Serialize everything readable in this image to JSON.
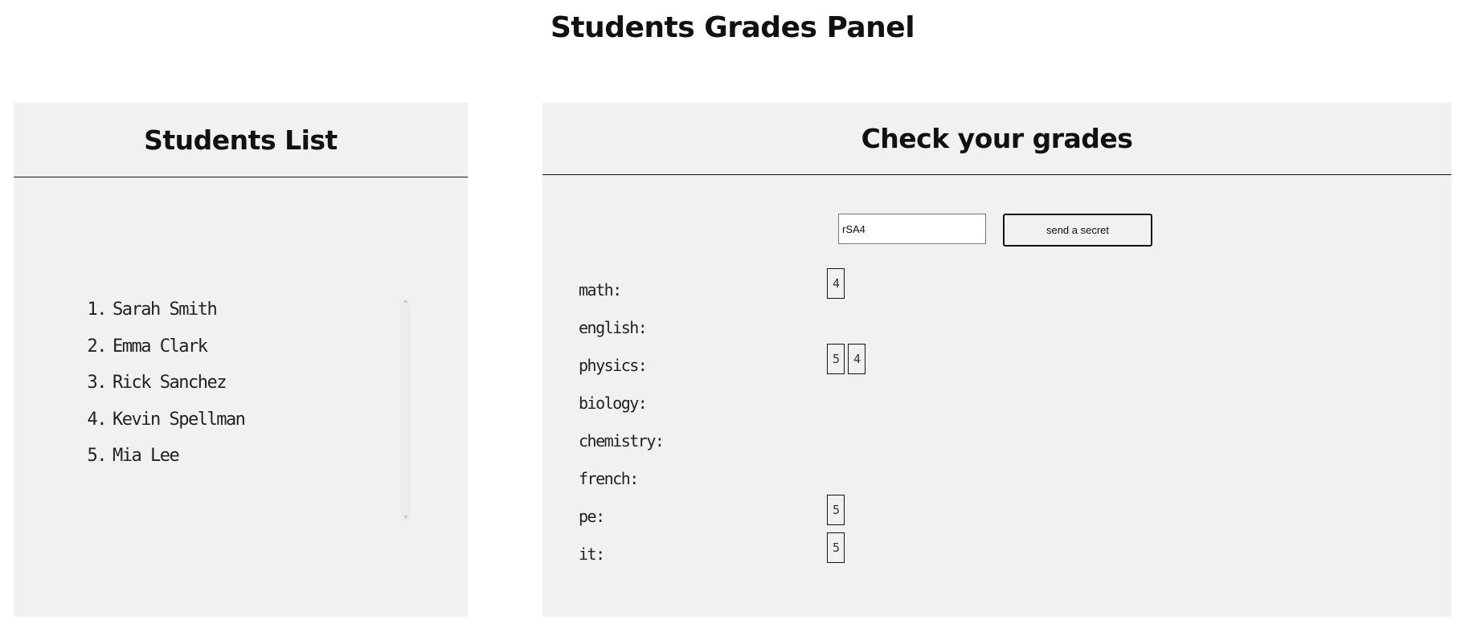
{
  "page": {
    "title": "Students Grades Panel"
  },
  "students_panel": {
    "title": "Students List",
    "students": [
      {
        "num": "1.",
        "name": "Sarah Smith"
      },
      {
        "num": "2.",
        "name": "Emma Clark"
      },
      {
        "num": "3.",
        "name": "Rick Sanchez"
      },
      {
        "num": "4.",
        "name": "Kevin Spellman"
      },
      {
        "num": "5.",
        "name": "Mia Lee"
      }
    ],
    "scroll_up_icon": "chevron-up-icon",
    "scroll_down_icon": "chevron-down-icon"
  },
  "grades_panel": {
    "title": "Check your grades",
    "secret_input_value": "rSA4",
    "send_button_label": "send a secret",
    "subjects": [
      {
        "label": "math:",
        "grades": [
          "4"
        ]
      },
      {
        "label": "english:",
        "grades": []
      },
      {
        "label": "physics:",
        "grades": [
          "5",
          "4"
        ]
      },
      {
        "label": "biology:",
        "grades": []
      },
      {
        "label": "chemistry:",
        "grades": []
      },
      {
        "label": "french:",
        "grades": []
      },
      {
        "label": "pe:",
        "grades": [
          "5"
        ]
      },
      {
        "label": "it:",
        "grades": [
          "5"
        ]
      }
    ]
  }
}
